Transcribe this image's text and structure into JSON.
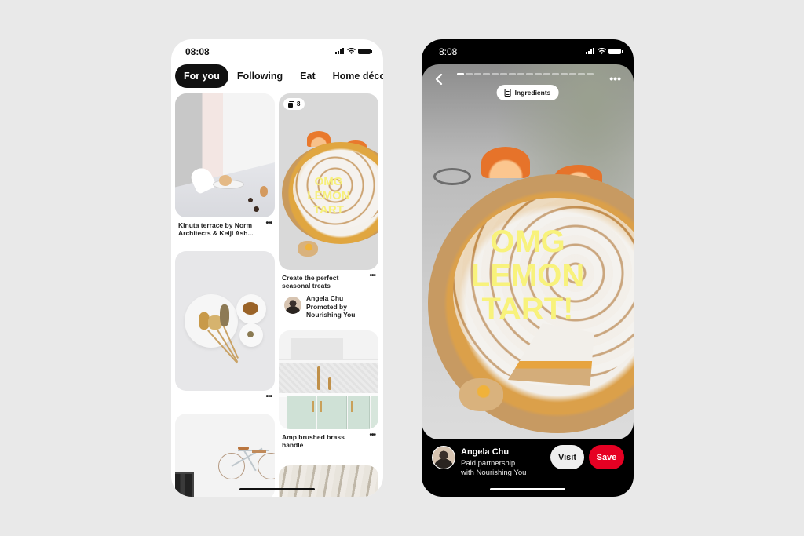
{
  "feed_screen": {
    "status_time": "08:08",
    "tabs": [
      {
        "label": "For you",
        "active": true
      },
      {
        "label": "Following",
        "active": false
      },
      {
        "label": "Eat",
        "active": false
      },
      {
        "label": "Home décor",
        "active": false
      }
    ],
    "left_column": [
      {
        "title": "Kinuta terrace by Norm Architects & Keiji Ash...",
        "more": "•••"
      },
      {
        "title": "",
        "more": "•••"
      },
      {
        "title": "",
        "more": ""
      }
    ],
    "right_column": [
      {
        "badge_count": "8",
        "overlay_text": "OMG LEMON TART",
        "overlay_lines": [
          "OMG",
          "LEMON",
          "TART"
        ],
        "title": "Create the perfect seasonal treats",
        "more": "•••",
        "creator": {
          "name": "Angela Chu",
          "line2": "Promoted by",
          "line3": "Nourishing You"
        }
      },
      {
        "title": "Amp brushed brass handle",
        "more": "•••"
      }
    ]
  },
  "pin_screen": {
    "status_time": "8:08",
    "story_pages_total": 16,
    "story_page_current": 1,
    "ingredients_label": "Ingredients",
    "more": "•••",
    "overlay_lines": [
      "OMG",
      "LEMON",
      "TART!"
    ],
    "creator_name": "Angela Chu",
    "creator_sub_line1": "Paid partnership",
    "creator_sub_line2": "with Nourishing You",
    "visit_label": "Visit",
    "save_label": "Save",
    "colors": {
      "save": "#e60023",
      "overlay_text": "#f8f27c"
    }
  }
}
